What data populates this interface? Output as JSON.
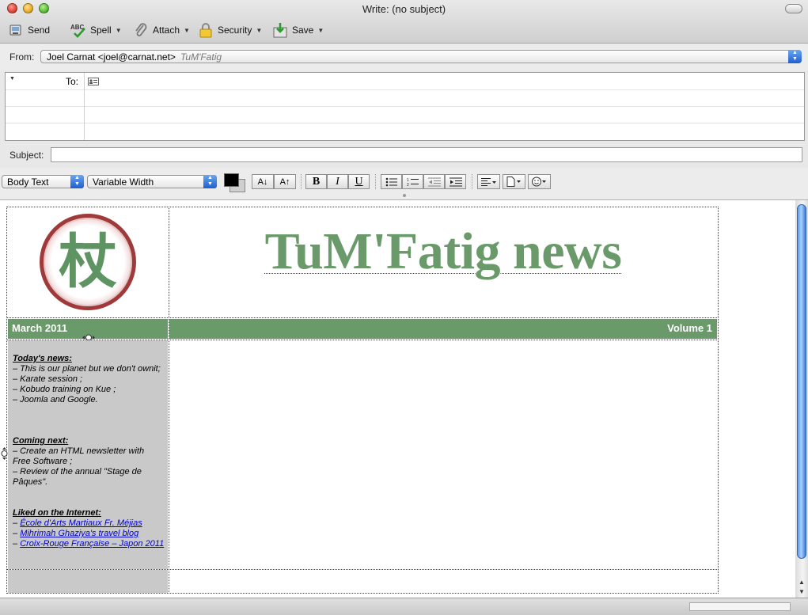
{
  "window": {
    "title": "Write: (no subject)"
  },
  "toolbar": {
    "send_label": "Send",
    "spell_label": "Spell",
    "attach_label": "Attach",
    "security_label": "Security",
    "save_label": "Save"
  },
  "from": {
    "label": "From:",
    "identity": "Joel Carnat <joel@carnat.net>",
    "signature": "TuM'Fatig"
  },
  "recipients": {
    "to_label": "To:"
  },
  "subject": {
    "label": "Subject:",
    "value": ""
  },
  "format_bar": {
    "paragraph_style": "Body Text",
    "font": "Variable Width",
    "smaller_label": "A↓",
    "larger_label": "A↑",
    "bold_label": "B",
    "italic_label": "I",
    "underline_label": "U",
    "colors": {
      "text": "#000000",
      "background": "#cfcfcf"
    }
  },
  "newsletter": {
    "logo_char": "杖",
    "title": "TuM'Fatig news",
    "date": "March 2011",
    "volume": "Volume 1",
    "colors": {
      "accent": "#6a9a6a",
      "sidebar_bg": "#c9c9c9",
      "logo_ring": "#a03a3a",
      "link": "#0000cc"
    },
    "todays_news": {
      "heading": "Today's news:",
      "items": [
        "– This is our planet but we don't ownit;",
        "– Karate session ;",
        "– Kobudo training on Kue ;",
        "– Joomla and Google."
      ]
    },
    "coming_next": {
      "heading": "Coming next:",
      "items": [
        "– Create an HTML newsletter with Free Software ;",
        "– Review of the annual \"Stage de Pâques\"."
      ]
    },
    "liked": {
      "heading": "Liked on the Internet:",
      "links": [
        "École d'Arts Martiaux Fr. Méjias",
        "Mihrimah Ghaziya's travel blog",
        "Croix-Rouge Française – Japon 2011"
      ]
    }
  }
}
